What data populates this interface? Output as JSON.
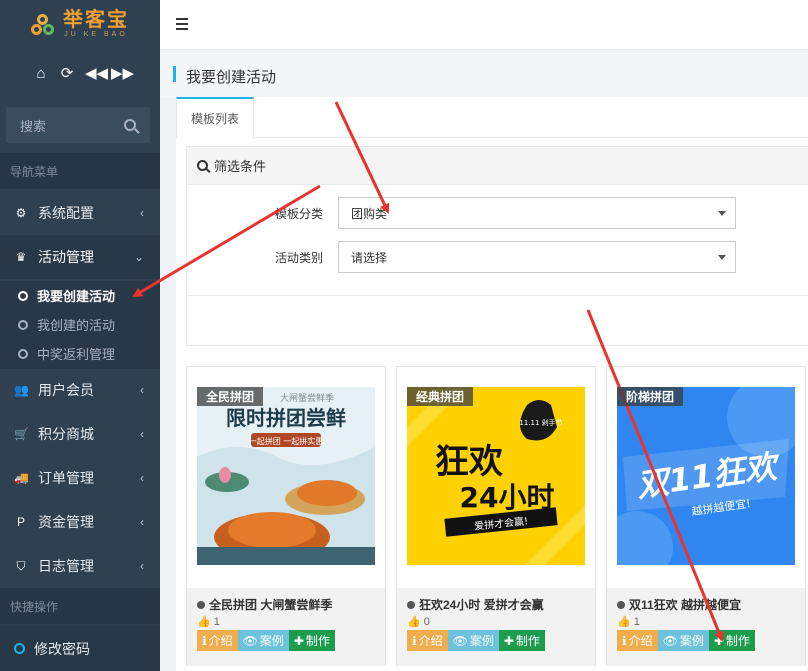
{
  "brand": {
    "title": "举客宝",
    "subtitle": "JU KE BAO"
  },
  "side_tools": [
    "home-icon",
    "refresh-icon",
    "backward-icon",
    "forward-icon"
  ],
  "search": {
    "placeholder": "搜索"
  },
  "sidebar": {
    "nav_header": "导航菜单",
    "items": [
      {
        "label": "系统配置",
        "icon": "gear-icon"
      },
      {
        "label": "活动管理",
        "icon": "trophy-icon"
      },
      {
        "label": "用户会员",
        "icon": "users-icon"
      },
      {
        "label": "积分商城",
        "icon": "cart-icon"
      },
      {
        "label": "订单管理",
        "icon": "truck-icon"
      },
      {
        "label": "资金管理",
        "icon": "paypal-icon"
      },
      {
        "label": "日志管理",
        "icon": "shield-icon"
      }
    ],
    "sub_items": [
      {
        "label": "我要创建活动",
        "active": true
      },
      {
        "label": "我创建的活动",
        "active": false
      },
      {
        "label": "中奖返利管理",
        "active": false
      }
    ],
    "quick_header": "快捷操作",
    "quick_items": [
      {
        "label": "修改密码"
      }
    ]
  },
  "page": {
    "title": "我要创建活动"
  },
  "tabs": [
    {
      "label": "模板列表",
      "active": true
    }
  ],
  "filter": {
    "heading": "筛选条件",
    "template_category": {
      "label": "模板分类",
      "value": "团购类"
    },
    "activity_type": {
      "label": "活动类别",
      "value": "请选择"
    }
  },
  "cards": [
    {
      "badge": "全民拼团",
      "title": "全民拼团 大闸蟹尝鲜季",
      "likes": "1",
      "image": {
        "line1": "大闸蟹尝鲜季",
        "line2": "限时拼团尝鲜",
        "line3": "一起拼团 一起拼实惠"
      }
    },
    {
      "badge": "经典拼团",
      "title": "狂欢24小时 爱拼才会赢",
      "likes": "0",
      "image": {
        "line1": "狂欢",
        "line2": "24小时",
        "line3": "爱拼才会赢!",
        "tag": "11.11 剁手节"
      }
    },
    {
      "badge": "阶梯拼团",
      "title": "双11狂欢 越拼越便宜",
      "likes": "1",
      "image": {
        "line1": "双11狂欢",
        "line2": "越拼越便宜!"
      }
    }
  ],
  "card_buttons": {
    "intro": "介绍",
    "case": "案例",
    "make": "制作"
  },
  "colors": {
    "sidebar": "#2f4050",
    "accent": "#1ab3ec",
    "intro": "#f0ad4e",
    "case": "#6cc2dd",
    "make": "#1c9d4d",
    "arrow": "#e8332f"
  }
}
